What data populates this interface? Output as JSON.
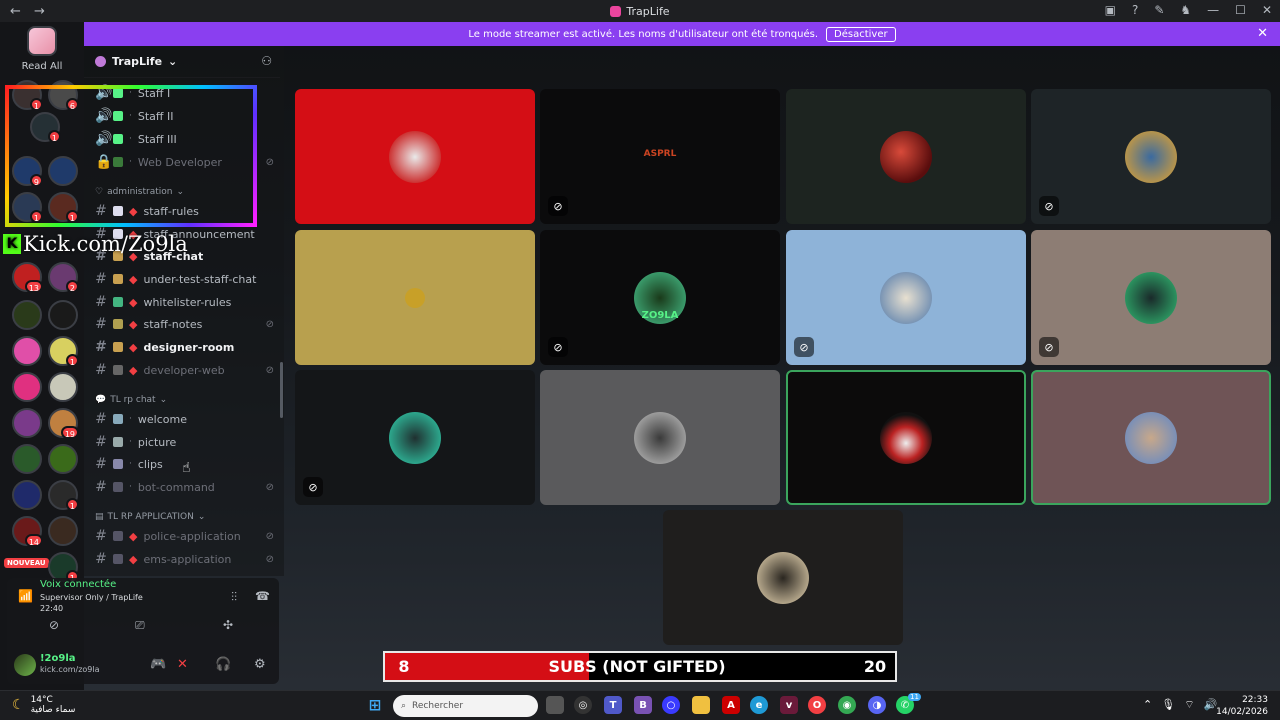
{
  "window": {
    "title": "TrapLife",
    "back": "←",
    "forward": "→",
    "controls": [
      "▣",
      "?",
      "✎",
      "♞",
      "—",
      "☐",
      "✕"
    ]
  },
  "servers": {
    "read_all": "Read All",
    "badges": [
      "1",
      "6",
      "1",
      "9",
      "1",
      "1",
      "8",
      "1",
      "13",
      "2",
      "1",
      "1",
      "1",
      "1",
      "19",
      "1",
      "14",
      "1"
    ],
    "nouveau": "NOUVEAU"
  },
  "overlay": {
    "kick_text": "Kick.com/Zo9la",
    "kick_letter": "K"
  },
  "banner": {
    "text": "Le mode streamer est activé. Les noms d'utilisateur ont été tronqués.",
    "button": "Désactiver"
  },
  "guild": {
    "name": "TrapLife"
  },
  "channels": [
    {
      "name": "Staff I"
    },
    {
      "name": "Staff II"
    },
    {
      "name": "Staff III"
    },
    {
      "name": "Web Developer"
    },
    {
      "name": "staff-rules"
    },
    {
      "name": "staff-announcement"
    },
    {
      "name": "staff-chat"
    },
    {
      "name": "under-test-staff-chat"
    },
    {
      "name": "whitelister-rules"
    },
    {
      "name": "staff-notes"
    },
    {
      "name": "designer-room"
    },
    {
      "name": "developer-web"
    },
    {
      "name": "welcome"
    },
    {
      "name": "picture"
    },
    {
      "name": "clips"
    },
    {
      "name": "bot-command"
    },
    {
      "name": "police-application"
    },
    {
      "name": "ems-application"
    }
  ],
  "categories": {
    "administration": "administration",
    "rp_chat": "TL rp chat",
    "rp_app": "TL RP APPLICATION"
  },
  "voice": {
    "status": "Voix connectée",
    "channel": "Supervisor Only / TrapLife",
    "time": "22:40"
  },
  "user": {
    "name": "!2o9la",
    "sub": "kick.com/zo9la"
  },
  "tiles": [
    {
      "bg": "#d40e15"
    },
    {
      "bg": "#0b0b0c",
      "text": "ASPRL"
    },
    {
      "bg": "#1d2420"
    },
    {
      "bg": "#1e2427"
    },
    {
      "bg": "#b8a04e"
    },
    {
      "bg": "#0b0b0c",
      "text": "ZO9LA"
    },
    {
      "bg": "#8eb3d8"
    },
    {
      "bg": "#8d7d74"
    },
    {
      "bg": "#141618"
    },
    {
      "bg": "#5a5a5c"
    },
    {
      "bg": "#0c0b0b"
    },
    {
      "bg": "#6f5456"
    },
    {
      "bg": "#1f1e1d"
    }
  ],
  "subs": {
    "current": "8",
    "label": "SUBS (NOT GIFTED)",
    "goal": "20",
    "progress": 0.4
  },
  "taskbar": {
    "temp": "14°C",
    "weather": "سماء صافية",
    "search": "Rechercher",
    "time": "22:33",
    "date": "14/02/2026",
    "badge": "11"
  }
}
